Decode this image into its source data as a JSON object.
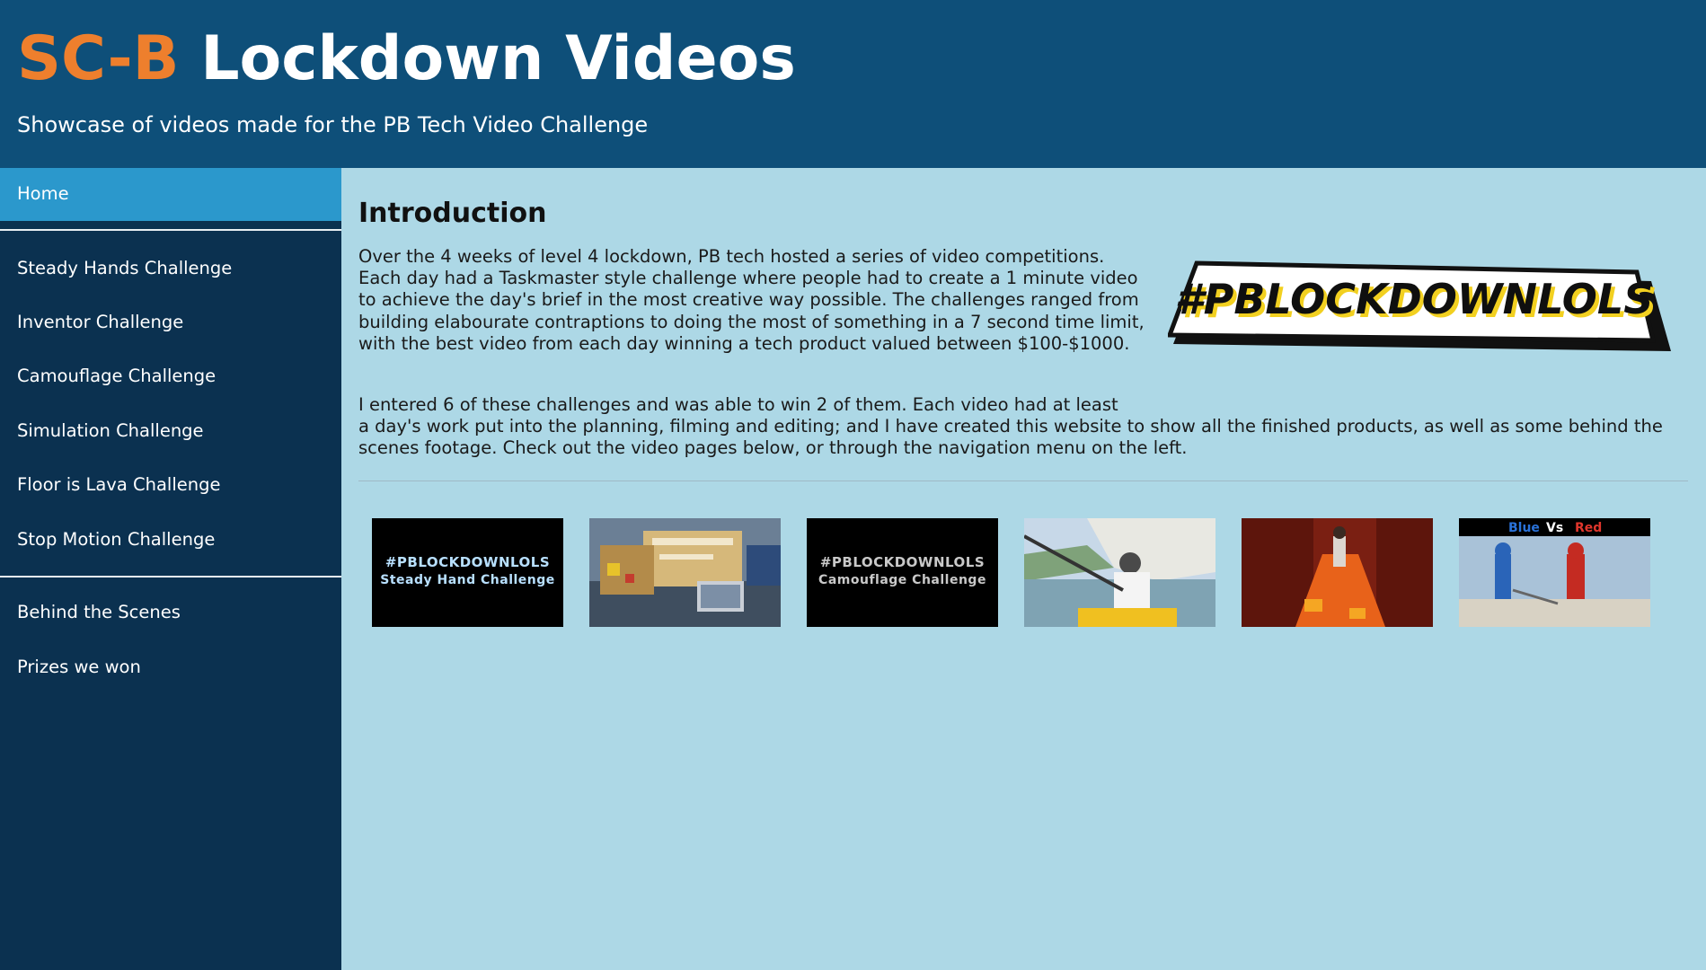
{
  "header": {
    "title_accent": "SC-B",
    "title_rest": "Lockdown Videos",
    "subtitle": "Showcase of videos made for the PB Tech Video Challenge"
  },
  "nav": {
    "home": "Home",
    "challenges": [
      "Steady Hands Challenge",
      "Inventor Challenge",
      "Camouflage Challenge",
      "Simulation Challenge",
      "Floor is Lava Challenge",
      "Stop Motion Challenge"
    ],
    "extras": [
      "Behind the Scenes",
      "Prizes we won"
    ]
  },
  "main": {
    "heading": "Introduction",
    "paragraph1": "Over the 4 weeks of level 4 lockdown, PB tech hosted a series of video competitions. Each day had a Taskmaster style challenge where people had to create a 1 minute video to achieve the day's brief in the most creative way possible. The challenges ranged from building elabourate contraptions to doing the most of something in a 7 second time limit, with the best video from each day winning a tech product valued between $100-$1000.",
    "paragraph2_line1": "I entered 6 of these challenges and was able to win 2 of them. Each video had at least",
    "paragraph2_rest": "a day's work put into the planning, filming and editing; and I have created this website to show all the finished products, as well as some behind the scenes footage. Check out the video pages below, or through the navigation menu on the left.",
    "banner_text": "#PBLOCKDOWNLOLS"
  },
  "thumbnails": {
    "steady": {
      "line1": "#PBLOCKDOWNLOLS",
      "line2": "Steady Hand Challenge"
    },
    "camo": {
      "line1": "#PBLOCKDOWNLOLS",
      "line2": "Camouflage Challenge"
    },
    "stop": {
      "blue": "Blue",
      "vs": "Vs",
      "red": "Red"
    }
  },
  "colors": {
    "header_bg": "#0e4f79",
    "accent_orange": "#ee7f2d",
    "sidebar_bg": "#0b3150",
    "active_nav": "#2b98cc",
    "content_bg": "#add8e6"
  }
}
